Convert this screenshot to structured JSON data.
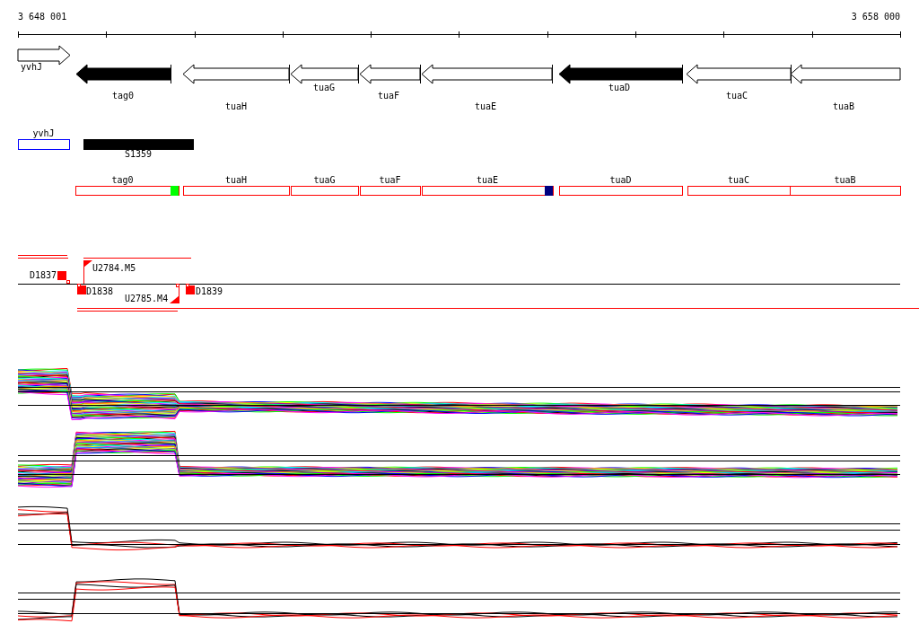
{
  "ruler": {
    "start": "3 648 001",
    "end": "3 658 000"
  },
  "genes": [
    {
      "name": "yvhJ",
      "kind": "forward",
      "filled": false
    },
    {
      "name": "tag0",
      "kind": "reverse",
      "filled": true
    },
    {
      "name": "tuaH",
      "kind": "reverse",
      "filled": false
    },
    {
      "name": "tuaG",
      "kind": "reverse",
      "filled": false
    },
    {
      "name": "tuaF",
      "kind": "reverse",
      "filled": false
    },
    {
      "name": "tuaE",
      "kind": "reverse",
      "filled": false
    },
    {
      "name": "tuaD",
      "kind": "reverse",
      "filled": true
    },
    {
      "name": "tuaC",
      "kind": "reverse",
      "filled": false
    },
    {
      "name": "tuaB",
      "kind": "reverse",
      "filled": false
    }
  ],
  "features": [
    {
      "name": "yvhJ",
      "kind": "outline"
    },
    {
      "name": "S1359",
      "kind": "solid"
    }
  ],
  "cds": [
    {
      "name": "tag0",
      "color": "#00ff00"
    },
    {
      "name": "tuaH"
    },
    {
      "name": "tuaG"
    },
    {
      "name": "tuaF"
    },
    {
      "name": "tuaE",
      "color": "#000080"
    },
    {
      "name": "tuaD"
    },
    {
      "name": "tuaC"
    },
    {
      "name": "tuaB"
    }
  ],
  "transcription": [
    {
      "label": "D1837",
      "kind": "block"
    },
    {
      "label": "U2784.M5",
      "kind": "flag"
    },
    {
      "label": "D1838",
      "kind": "block"
    },
    {
      "label": "U2785.M4",
      "kind": "flag"
    },
    {
      "label": "D1839",
      "kind": "block"
    }
  ]
}
